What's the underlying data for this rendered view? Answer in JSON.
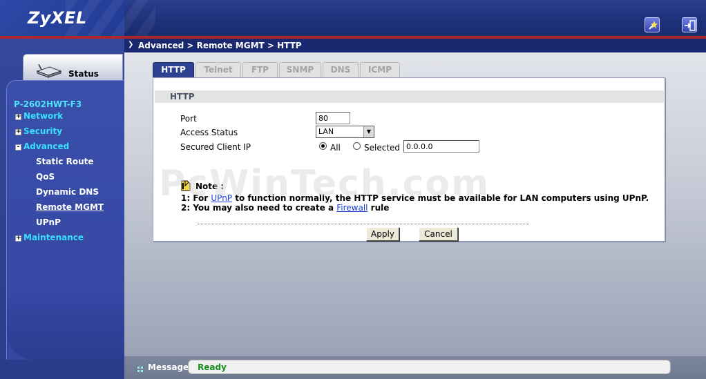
{
  "header": {
    "logo": "ZyXEL",
    "wizard_icon": "wizard-wand-icon",
    "logout_icon": "logout-icon"
  },
  "breadcrumb": "Advanced > Remote MGMT > HTTP",
  "sidebar": {
    "status_label": "Status",
    "model": "P-2602HWT-F3",
    "items": [
      {
        "label": "Network",
        "expander": "+"
      },
      {
        "label": "Security",
        "expander": "+"
      },
      {
        "label": "Advanced",
        "expander": "-"
      },
      {
        "label": "Maintenance",
        "expander": "+"
      }
    ],
    "advanced_sub": [
      "Static Route",
      "QoS",
      "Dynamic DNS",
      "Remote MGMT",
      "UPnP"
    ]
  },
  "tabs": [
    "HTTP",
    "Telnet",
    "FTP",
    "SNMP",
    "DNS",
    "ICMP"
  ],
  "form": {
    "section_title": "HTTP",
    "port_label": "Port",
    "port_value": "80",
    "access_label": "Access Status",
    "access_value": "LAN",
    "client_ip_label": "Secured Client IP",
    "radio_all": "All",
    "radio_selected": "Selected",
    "client_ip_value": "0.0.0.0"
  },
  "note": {
    "title": "Note :",
    "line1_prefix": "1: For ",
    "line1_link": "UPnP",
    "line1_suffix": " to function normally, the HTTP service must be available for LAN computers using UPnP.",
    "line2_prefix": "2: You may also need to create a ",
    "line2_link": "Firewall",
    "line2_suffix": " rule"
  },
  "buttons": {
    "apply": "Apply",
    "cancel": "Cancel"
  },
  "watermark": "PcWinTech.com",
  "statusbar": {
    "label": "Message",
    "text": "Ready"
  },
  "colors": {
    "header_blue": "#1d2f78",
    "accent_red": "#b0262a",
    "nav_cyan": "#37e0ff",
    "active_tab": "#2e4091",
    "status_green": "#178e1b"
  }
}
